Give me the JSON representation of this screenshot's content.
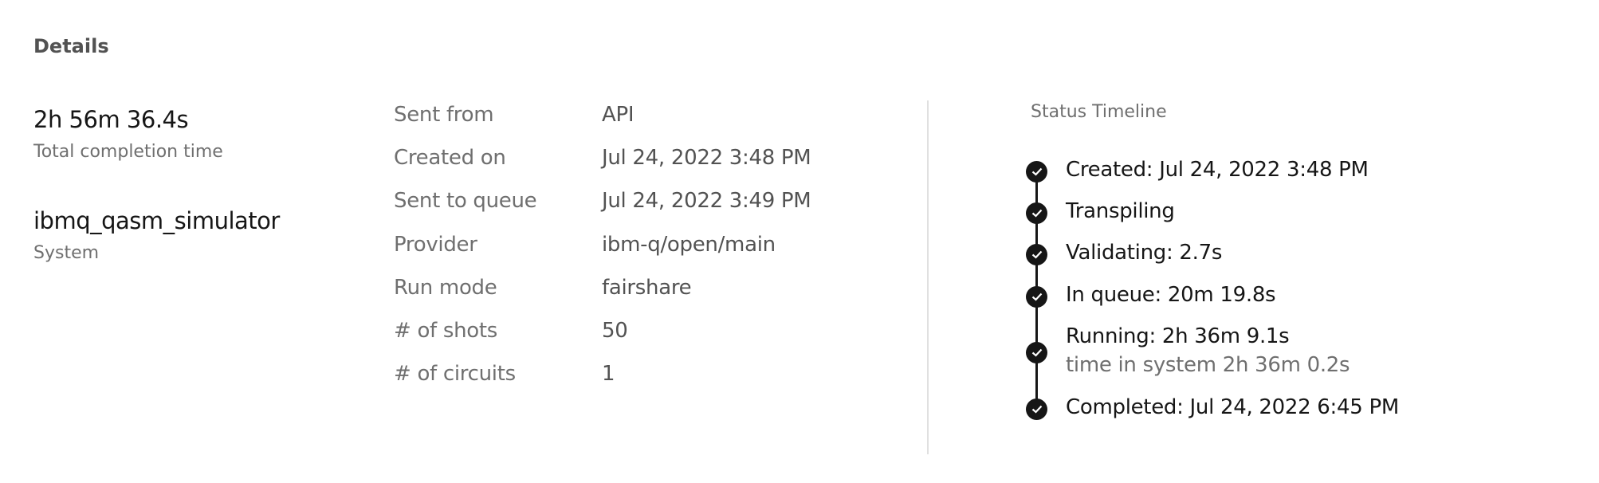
{
  "section_title": "Details",
  "summary": {
    "total_time": "2h 56m 36.4s",
    "total_time_label": "Total completion time",
    "system": "ibmq_qasm_simulator",
    "system_label": "System"
  },
  "details": [
    {
      "label": "Sent from",
      "value": "API"
    },
    {
      "label": "Created on",
      "value": "Jul 24, 2022 3:48 PM"
    },
    {
      "label": "Sent to queue",
      "value": "Jul 24, 2022 3:49 PM"
    },
    {
      "label": "Provider",
      "value": "ibm-q/open/main"
    },
    {
      "label": "Run mode",
      "value": "fairshare"
    },
    {
      "label": "# of shots",
      "value": "50"
    },
    {
      "label": "# of circuits",
      "value": "1"
    }
  ],
  "timeline": {
    "title": "Status Timeline",
    "icon": "checkmark-filled-icon",
    "items": [
      {
        "text": "Created: Jul 24, 2022 3:48 PM"
      },
      {
        "text": "Transpiling"
      },
      {
        "text": "Validating: 2.7s"
      },
      {
        "text": "In queue: 20m 19.8s"
      },
      {
        "text": "Running: 2h 36m 9.1s",
        "sub": "time in system 2h 36m 0.2s"
      },
      {
        "text": "Completed: Jul 24, 2022 6:45 PM"
      }
    ]
  }
}
